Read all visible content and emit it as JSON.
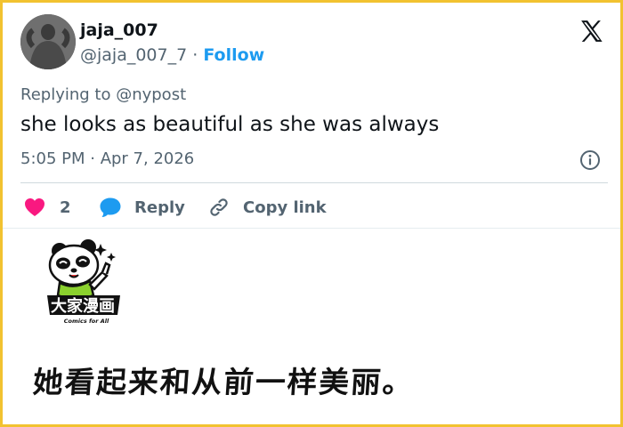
{
  "tweet": {
    "display_name": "jaja_007",
    "handle": "@jaja_007_7",
    "separator": " · ",
    "follow_label": "Follow",
    "replying_to": "Replying to @nypost",
    "text": "she looks as beautiful as she was always",
    "timestamp": "5:05 PM · Apr 7, 2026",
    "actions": {
      "like_count": "2",
      "reply_label": "Reply",
      "copy_label": "Copy link"
    }
  },
  "icons": {
    "brand": "x-logo-icon",
    "info": "info-icon",
    "like": "heart-icon",
    "reply": "speech-bubble-icon",
    "copy": "link-icon"
  },
  "colors": {
    "border": "#f2c230",
    "link_blue": "#1d9bf0",
    "heart": "#f91880",
    "muted_text": "#536471"
  },
  "overlay": {
    "logo_text": "大家漫画",
    "logo_subtext": "Comics for All",
    "caption": "她看起来和从前一样美丽。"
  }
}
